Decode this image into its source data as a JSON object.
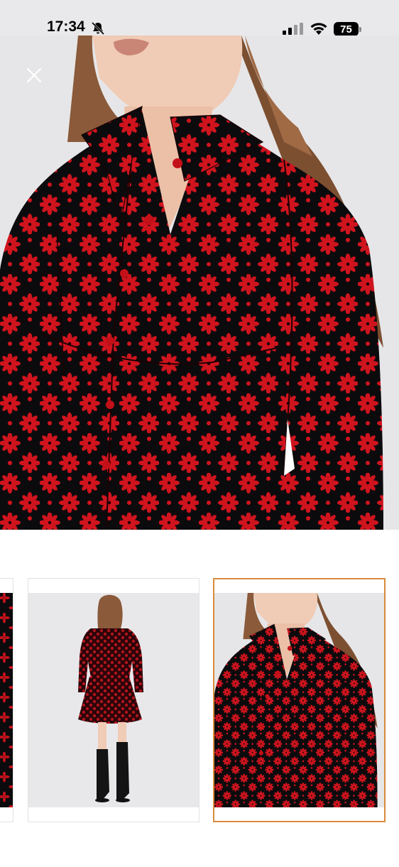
{
  "status_bar": {
    "time": "17:34",
    "battery_level": "75",
    "icons": [
      "bell-slash-icon",
      "signal-icon",
      "wifi-icon",
      "battery-icon"
    ]
  },
  "viewer": {
    "close_icon": "close-icon",
    "selected_index": 2,
    "thumbnails": [
      {
        "name": "thumbnail-prev-partial"
      },
      {
        "name": "thumbnail-back-view"
      },
      {
        "name": "thumbnail-front-closeup"
      }
    ]
  },
  "colors": {
    "fabric_red": "#d0141e",
    "fabric_black": "#0b0b0d",
    "selected_border": "#d98b3a",
    "background": "#e4e4e6"
  }
}
